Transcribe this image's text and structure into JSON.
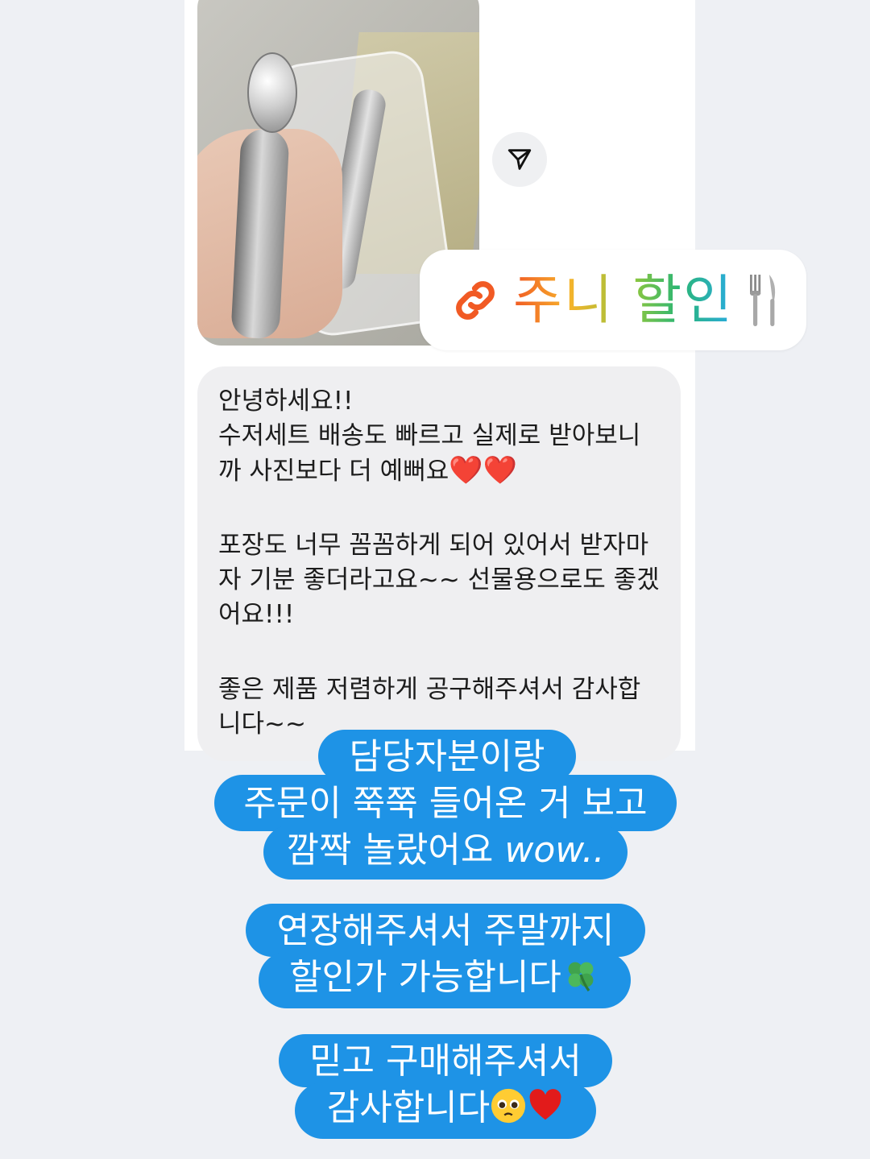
{
  "dm": {
    "photo": {
      "description_icon": "product-photo"
    },
    "share_icon": "send-icon",
    "link_sticker": {
      "icon": "link-icon",
      "label": "주니 할인",
      "trailing_icon": "fork-knife-icon"
    },
    "received_message": {
      "lines": [
        "안녕하세요!!",
        "수저세트 배송도 빠르고 실제로 받아보니",
        "까 사진보다 더 예뻐요",
        "",
        "포장도 너무 꼼꼼하게 되어 있어서 받자마",
        "자 기분 좋더라고요~~ 선물용으로도 좋겠",
        "어요!!!",
        "",
        "좋은 제품 저렴하게 공구해주셔서 감사합",
        "니다~~"
      ],
      "heart_emojis": "❤️❤️"
    }
  },
  "stickers": {
    "block1": {
      "line1": "담당자분이랑",
      "line2": "주문이 쭉쭉 들어온 거 보고",
      "line3_text": "깜짝 놀랐어요 ",
      "line3_wow": "wow.."
    },
    "block2": {
      "line1": "연장해주셔서 주말까지",
      "line2_text": "할인가 가능합니다",
      "line2_icon": "four-leaf-clover-icon"
    },
    "block3": {
      "line1": "믿고 구매해주셔서",
      "line2_text": "감사합니다",
      "line2_icons": [
        "pleading-face-icon",
        "heart-icon"
      ]
    }
  },
  "colors": {
    "sticker_blue": "#1e93e6",
    "bubble_gray": "#efeff1",
    "background": "#eef0f4"
  }
}
